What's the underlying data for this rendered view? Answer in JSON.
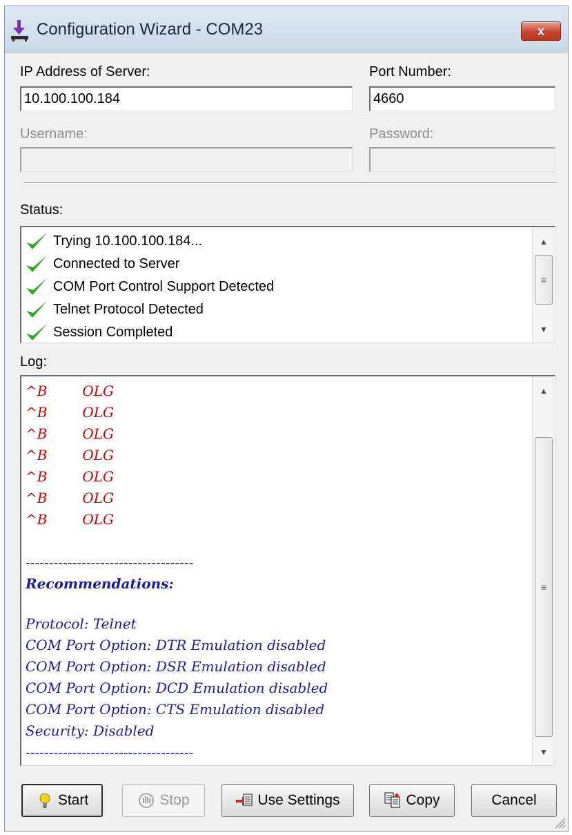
{
  "window": {
    "title": "Configuration Wizard - COM23",
    "close_label": "x"
  },
  "server": {
    "ip_label": "IP Address of Server:",
    "ip_value": "10.100.100.184",
    "port_label": "Port Number:",
    "port_value": "4660",
    "username_label": "Username:",
    "username_value": "",
    "password_label": "Password:",
    "password_value": ""
  },
  "status": {
    "label": "Status:",
    "items": [
      "Trying 10.100.100.184...",
      "Connected to Server",
      "COM Port Control Support Detected",
      "Telnet Protocol Detected",
      "Session Completed"
    ]
  },
  "log": {
    "label": "Log:",
    "lines": [
      "^B        OLG",
      "^B        OLG",
      "^B        OLG",
      "^B        OLG",
      "^B        OLG",
      "^B        OLG",
      "^B        OLG",
      "",
      "------------------------------------",
      "Recommendations:",
      "",
      "Protocol: Telnet",
      "COM Port Option: DTR Emulation disabled",
      "COM Port Option: DSR Emulation disabled",
      "COM Port Option: DCD Emulation disabled",
      "COM Port Option: CTS Emulation disabled",
      "Security: Disabled",
      "------------------------------------"
    ]
  },
  "buttons": {
    "start": "Start",
    "stop": "Stop",
    "use_settings": "Use Settings",
    "copy": "Copy",
    "cancel": "Cancel"
  },
  "colors": {
    "log_red": "#d40000",
    "log_blue": "#1a1ab0",
    "check_green": "#2eaa1e"
  },
  "icons": {
    "app": "download-arrow-icon",
    "status_check": "green-checkmark-icon",
    "start": "lightbulb-icon",
    "stop": "stop-hand-icon",
    "use_settings": "apply-settings-icon",
    "copy": "copy-icon"
  }
}
